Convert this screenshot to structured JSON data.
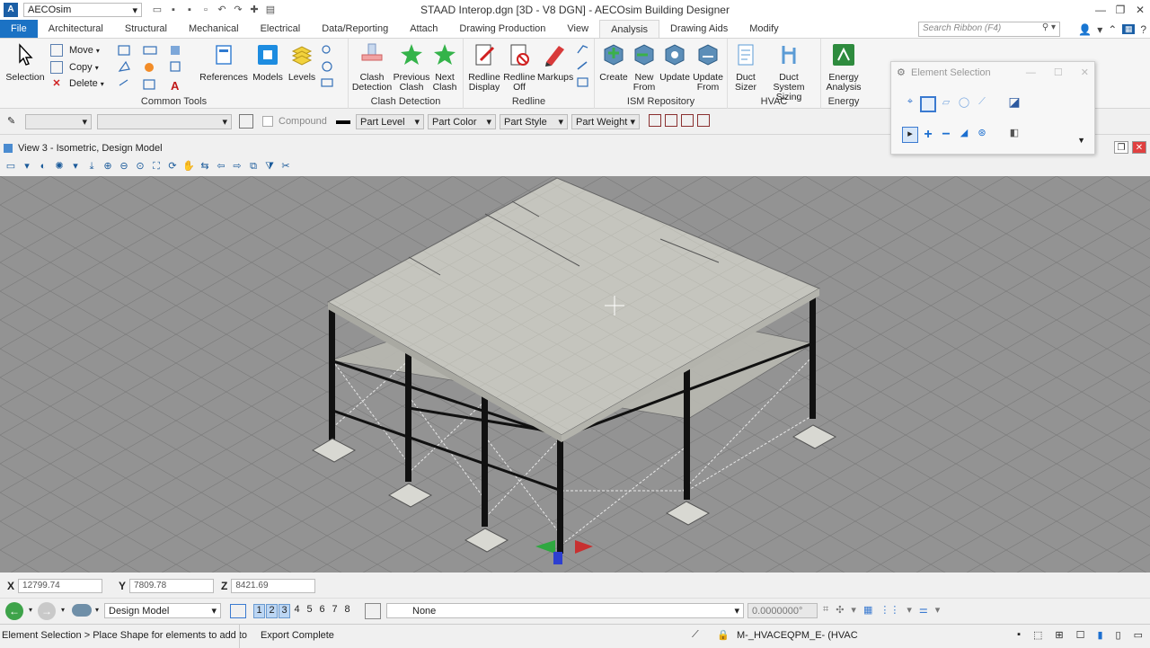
{
  "titlebar": {
    "workspace": "AECOsim",
    "title": "STAAD Interop.dgn [3D - V8 DGN] - AECOsim Building Designer"
  },
  "menu": {
    "file": "File",
    "tabs": [
      "Architectural",
      "Structural",
      "Mechanical",
      "Electrical",
      "Data/Reporting",
      "Attach",
      "Drawing Production",
      "View",
      "Analysis",
      "Drawing Aids",
      "Modify"
    ],
    "active": "Analysis",
    "search_placeholder": "Search Ribbon (F4)"
  },
  "ribbon": {
    "selection": "Selection",
    "move": "Move",
    "copy": "Copy",
    "delete": "Delete",
    "references": "References",
    "models": "Models",
    "levels": "Levels",
    "common_tools": "Common Tools",
    "clash_detection_btn": "Clash\nDetection",
    "clash_detection_line1": "Clash",
    "clash_detection_line2": "Detection",
    "previous_clash_line1": "Previous",
    "previous_clash_line2": "Clash",
    "next_clash_line1": "Next",
    "next_clash_line2": "Clash",
    "clash_group": "Clash Detection",
    "redline_display_1": "Redline",
    "redline_display_2": "Display",
    "redline_off_1": "Redline",
    "redline_off_2": "Off",
    "markups": "Markups",
    "redline_group": "Redline",
    "create": "Create",
    "new_from_1": "New",
    "new_from_2": "From",
    "update": "Update",
    "update_from_1": "Update",
    "update_from_2": "From",
    "ism_group": "ISM Repository",
    "duct_sizer_1": "Duct",
    "duct_sizer_2": "Sizer",
    "duct_system_1": "Duct",
    "duct_system_2": "System Sizing",
    "hvac_group": "HVAC",
    "energy_1": "Energy",
    "energy_2": "Analysis",
    "energy_group": "Energy"
  },
  "toolbar2": {
    "compound": "Compound",
    "part_level": "Part Level",
    "part_color": "Part Color",
    "part_style": "Part Style",
    "part_weight": "Part Weight"
  },
  "view": {
    "title": "View 3 - Isometric, Design Model"
  },
  "element_selection": {
    "title": "Element Selection"
  },
  "coords": {
    "x_label": "X",
    "x": "12799.74",
    "y_label": "Y",
    "y": "7809.78",
    "z_label": "Z",
    "z": "8421.69"
  },
  "navbar": {
    "model": "Design Model",
    "views": [
      "1",
      "2",
      "3",
      "4",
      "5",
      "6",
      "7",
      "8"
    ],
    "none": "None",
    "angle": "0.0000000°"
  },
  "status": {
    "prompt": "Element Selection > Place Shape for elements to add to",
    "message": "Export Complete",
    "level": "M-_HVACEQPM_E- (HVAC"
  }
}
